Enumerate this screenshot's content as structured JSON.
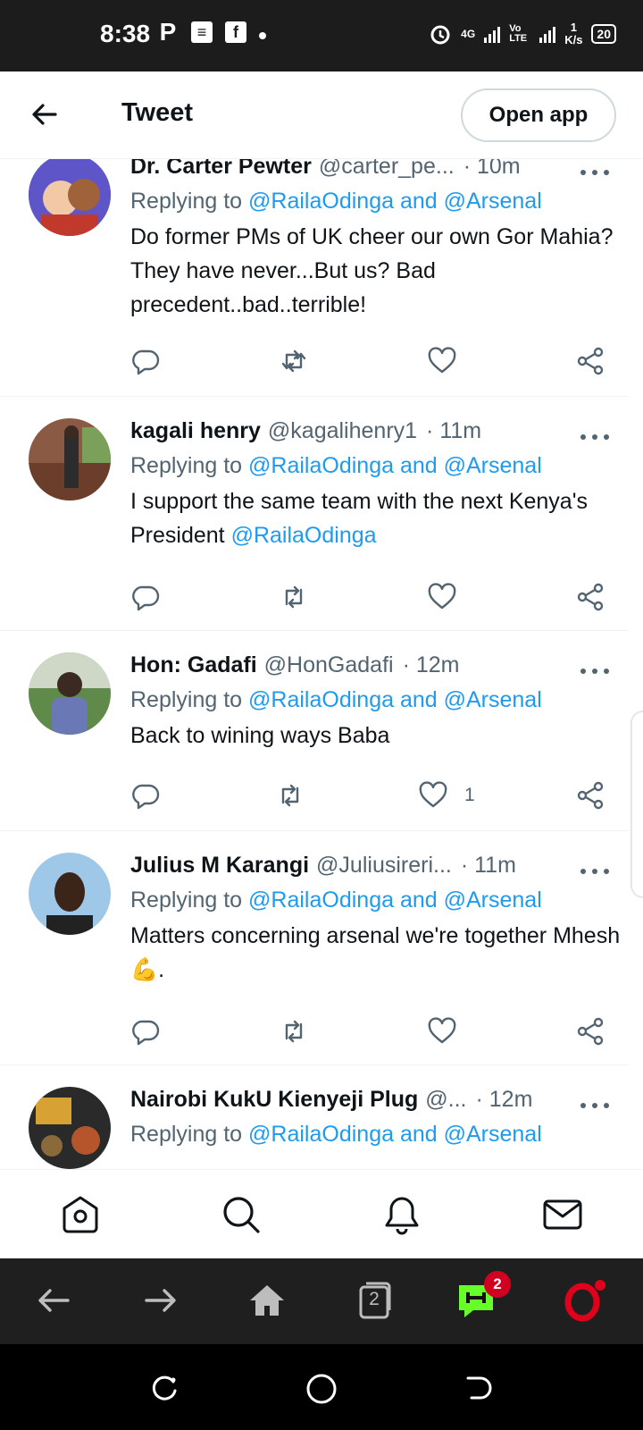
{
  "status_bar": {
    "time": "8:38",
    "icons": [
      "p-icon",
      "news-icon",
      "facebook-icon",
      "dot"
    ],
    "network_4g": "4G",
    "volte": "Vo LTE",
    "speed_value": "1",
    "speed_unit": "K/s",
    "battery": "20"
  },
  "header": {
    "title": "Tweet",
    "open_app_label": "Open app"
  },
  "tweets": [
    {
      "name": "Dr. Carter Pewter",
      "handle": "@carter_pe...",
      "time": "· 10m",
      "replying_prefix": "Replying to ",
      "replying_to": "@RailaOdinga and @Arsenal",
      "text": "Do former PMs of UK cheer our own Gor Mahia? They have never...But us? Bad precedent..bad..terrible!",
      "likes": ""
    },
    {
      "name": "kagali henry",
      "handle": "@kagalihenry1",
      "time": "· 11m",
      "replying_prefix": "Replying to ",
      "replying_to": "@RailaOdinga and @Arsenal",
      "text": "I support the same team with the next Kenya's President ",
      "text_mention": "@RailaOdinga",
      "likes": ""
    },
    {
      "name": "Hon: Gadafi",
      "handle": "@HonGadafi",
      "time": "· 12m",
      "replying_prefix": "Replying to ",
      "replying_to": "@RailaOdinga and @Arsenal",
      "text": "Back to wining ways Baba",
      "likes": "1"
    },
    {
      "name": "Julius M Karangi",
      "handle": "@Juliusireri...",
      "time": "· 11m",
      "replying_prefix": "Replying to ",
      "replying_to": "@RailaOdinga and @Arsenal",
      "text": "Matters concerning arsenal we're together Mhesh 💪.",
      "likes": ""
    },
    {
      "name": "Nairobi KukU Kienyeji Plug",
      "handle": "@...",
      "time": "· 12m",
      "replying_prefix": "Replying to ",
      "replying_to": "@RailaOdinga and @Arsenal",
      "text": "",
      "likes": ""
    }
  ],
  "browser_bar": {
    "tabs_count": "2",
    "notification_badge": "2"
  },
  "colors": {
    "link": "#1d9bf0",
    "secondary_text": "#536471",
    "status_bar_bg": "#1c1c1c",
    "browser_bar_bg": "#1f1f1f",
    "badge_red": "#d10021"
  }
}
